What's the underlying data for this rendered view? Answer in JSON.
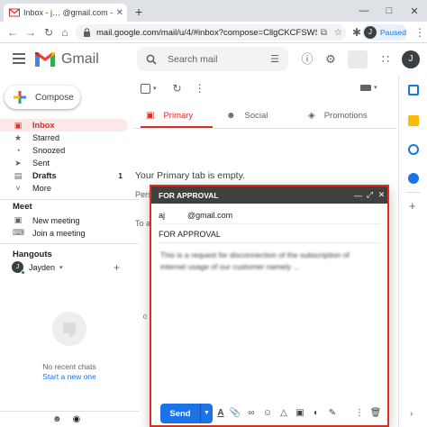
{
  "browser": {
    "tab_title": "Inbox - j…   @gmail.com - G",
    "tab_close": "✕",
    "new_tab": "+",
    "window_controls": [
      "—",
      "□",
      "✕"
    ],
    "url": "mail.google.com/mail/u/4/#inbox?compose=CllgCKCFSWSLS…",
    "profile_initial": "J",
    "profile_status": "Paused"
  },
  "header": {
    "app_name": "Gmail",
    "search_placeholder": "Search mail",
    "account_initial": "J"
  },
  "compose_button": {
    "label": "Compose"
  },
  "nav": [
    {
      "label": "Inbox",
      "count": "",
      "icon": "inbox-icon",
      "glyph": "▣"
    },
    {
      "label": "Starred",
      "count": "",
      "icon": "star-icon",
      "glyph": "★"
    },
    {
      "label": "Snoozed",
      "count": "",
      "icon": "clock-icon",
      "glyph": "◔"
    },
    {
      "label": "Sent",
      "count": "",
      "icon": "send-icon",
      "glyph": "➤"
    },
    {
      "label": "Drafts",
      "count": "1",
      "icon": "draft-icon",
      "glyph": "▤"
    },
    {
      "label": "More",
      "count": "",
      "icon": "chevron-down-icon",
      "glyph": "˅"
    }
  ],
  "meet": {
    "title": "Meet",
    "new_meeting": "New meeting",
    "join_meeting": "Join a meeting"
  },
  "hangouts": {
    "title": "Hangouts",
    "user_name": "Jayden",
    "user_initial": "J",
    "no_recent": "No recent chats",
    "start_new": "Start a new one"
  },
  "tabs": [
    {
      "label": "Primary",
      "icon": "inbox-icon"
    },
    {
      "label": "Social",
      "icon": "people-icon"
    },
    {
      "label": "Promotions",
      "icon": "tag-icon"
    }
  ],
  "empty_message": "Your Primary tab is empty.",
  "clipped_text": {
    "line1": "Pers",
    "line2": "To a",
    "zero": "0"
  },
  "compose": {
    "title": "FOR APPROVAL",
    "to": "aj          @gmail.com",
    "subject": "FOR APPROVAL",
    "body": "This is a request for disconnection of the subscription of internet usage of our customer namely ...",
    "send_label": "Send"
  },
  "colors": {
    "accent_red": "#d93025",
    "primary_blue": "#1a73e8",
    "compose_header": "#404040"
  }
}
